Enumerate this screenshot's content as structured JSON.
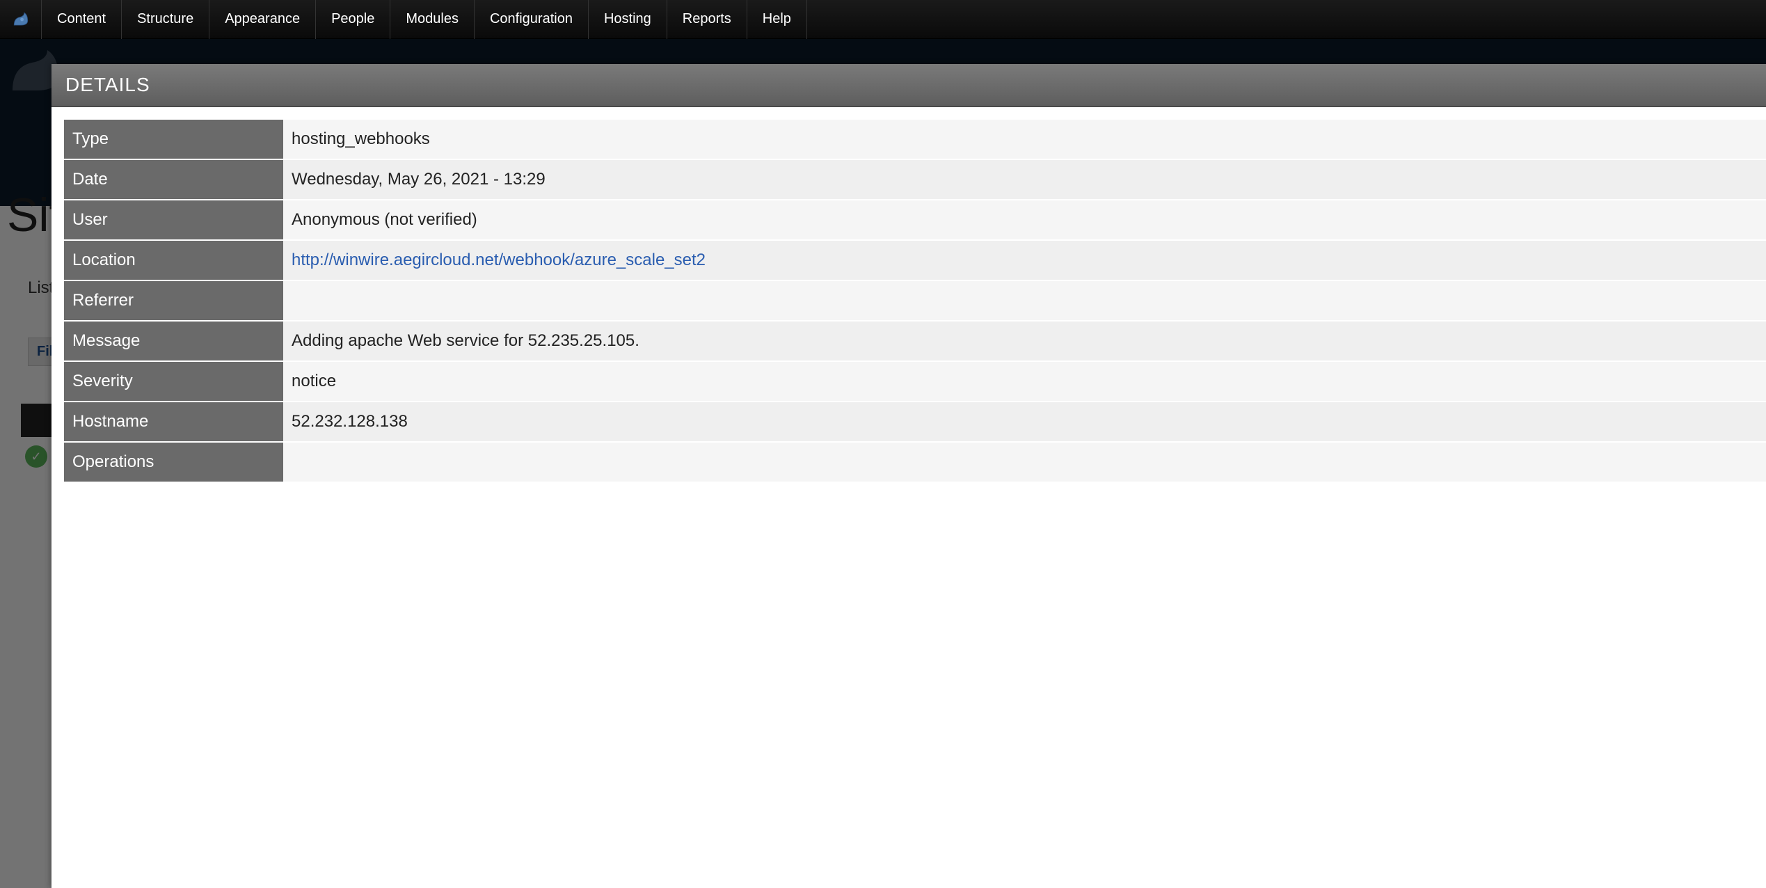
{
  "toolbar": {
    "items": [
      "Content",
      "Structure",
      "Appearance",
      "People",
      "Modules",
      "Configuration",
      "Hosting",
      "Reports",
      "Help"
    ]
  },
  "background_page": {
    "title_fragment": "Sit",
    "list_label": "List",
    "filter_label": "Filt"
  },
  "modal": {
    "title": "DETAILS",
    "rows": [
      {
        "label": "Type",
        "value": "hosting_webhooks",
        "is_link": false
      },
      {
        "label": "Date",
        "value": "Wednesday, May 26, 2021 - 13:29",
        "is_link": false
      },
      {
        "label": "User",
        "value": "Anonymous (not verified)",
        "is_link": false
      },
      {
        "label": "Location",
        "value": "http://winwire.aegircloud.net/webhook/azure_scale_set2",
        "is_link": true
      },
      {
        "label": "Referrer",
        "value": "",
        "is_link": false
      },
      {
        "label": "Message",
        "value": "Adding apache Web service for 52.235.25.105.",
        "is_link": false
      },
      {
        "label": "Severity",
        "value": "notice",
        "is_link": false
      },
      {
        "label": "Hostname",
        "value": "52.232.128.138",
        "is_link": false
      },
      {
        "label": "Operations",
        "value": "",
        "is_link": false
      }
    ]
  }
}
